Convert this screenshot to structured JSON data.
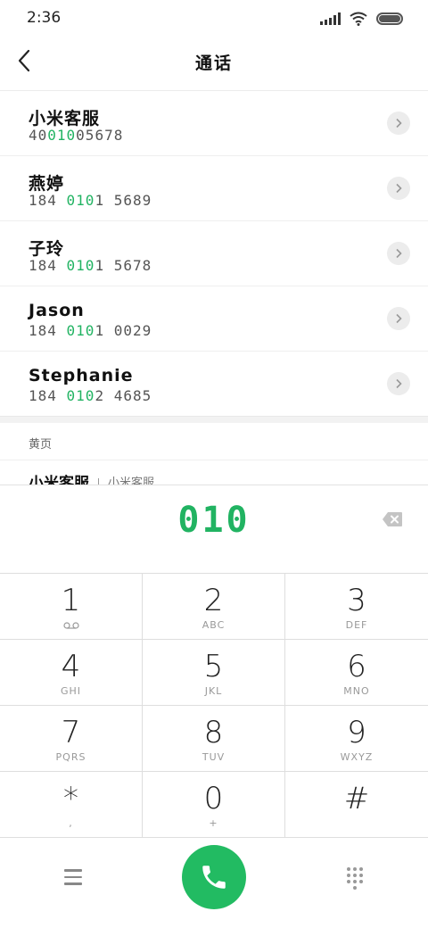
{
  "status_bar": {
    "time": "2:36"
  },
  "header": {
    "title": "通话"
  },
  "contacts": [
    {
      "name": "小米客服",
      "number_pre": "40",
      "number_hl": "010",
      "number_post": "05678"
    },
    {
      "name": "燕婷",
      "number_pre": "184 ",
      "number_hl": "010",
      "number_post": "1 5689"
    },
    {
      "name": "子玲",
      "number_pre": "184 ",
      "number_hl": "010",
      "number_post": "1 5678"
    },
    {
      "name": "Jason",
      "number_pre": "184 ",
      "number_hl": "010",
      "number_post": "1 0029"
    },
    {
      "name": "Stephanie",
      "number_pre": "184 ",
      "number_hl": "010",
      "number_post": "2 4685"
    }
  ],
  "yellow_pages": {
    "title": "黄页",
    "name": "小米客服",
    "tag": "小米客服"
  },
  "dialpad": {
    "digits": "010",
    "keys": [
      {
        "digit": "1",
        "sub": ""
      },
      {
        "digit": "2",
        "sub": "ABC"
      },
      {
        "digit": "3",
        "sub": "DEF"
      },
      {
        "digit": "4",
        "sub": "GHI"
      },
      {
        "digit": "5",
        "sub": "JKL"
      },
      {
        "digit": "6",
        "sub": "MNO"
      },
      {
        "digit": "7",
        "sub": "PQRS"
      },
      {
        "digit": "8",
        "sub": "TUV"
      },
      {
        "digit": "9",
        "sub": "WXYZ"
      },
      {
        "digit": "*",
        "sub": ","
      },
      {
        "digit": "0",
        "sub": "+"
      },
      {
        "digit": "#",
        "sub": ""
      }
    ]
  },
  "icons": {
    "back": "back-arrow-icon",
    "detail": "chevron-right-icon",
    "delete": "backspace-icon",
    "menu": "menu-icon",
    "call": "phone-icon",
    "keypad": "keypad-icon",
    "voicemail": "voicemail-icon"
  },
  "colors": {
    "accent": "#21b362",
    "call_button": "#22bb62"
  }
}
